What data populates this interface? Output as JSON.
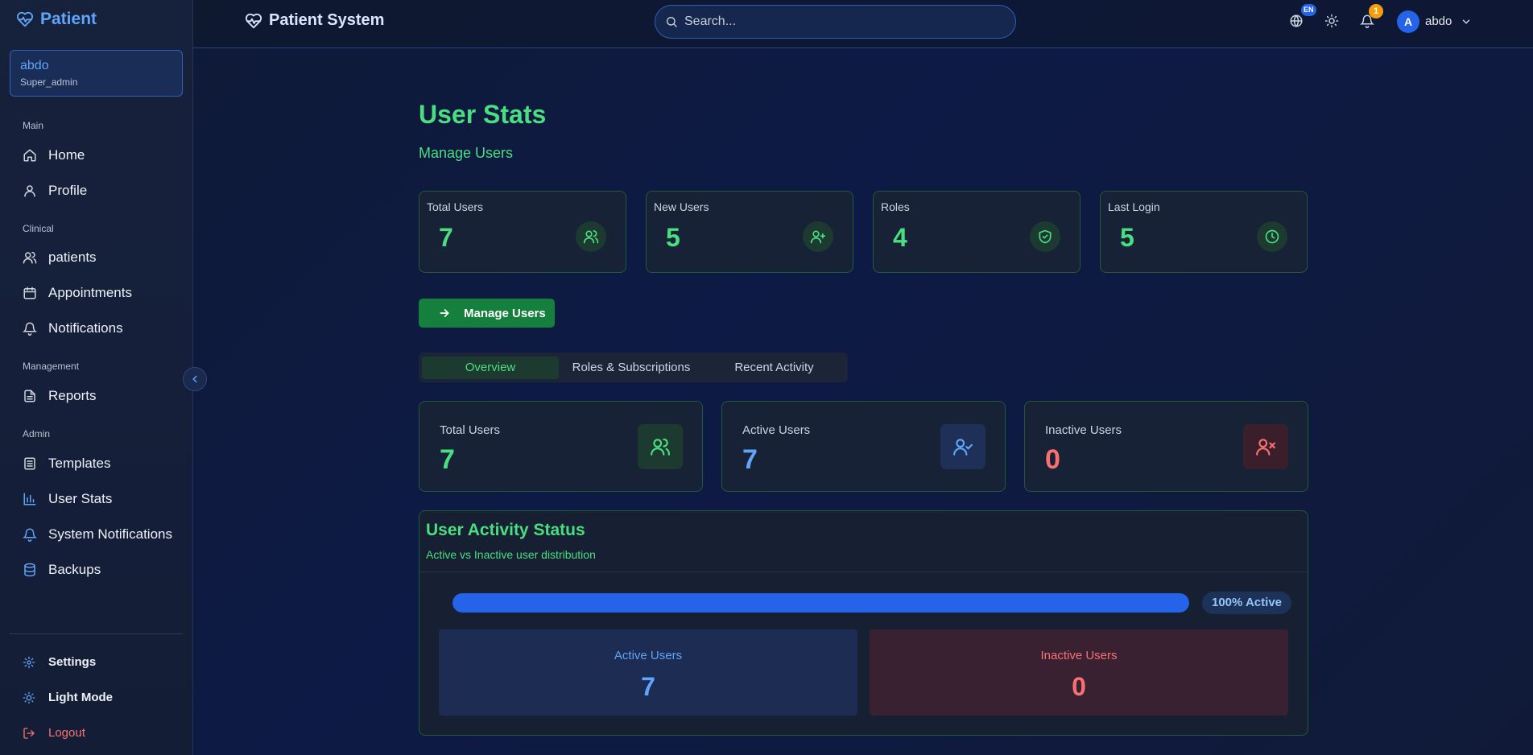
{
  "colors": {
    "accent_green": "#4ade80",
    "accent_blue": "#60a5fa",
    "danger_red": "#f87171",
    "progress_blue": "#2563eb",
    "button_green": "#15803d"
  },
  "sidebar": {
    "brand": "Patient",
    "user": {
      "name": "abdo",
      "role": "Super_admin"
    },
    "sections": {
      "main": "Main",
      "clinical": "Clinical",
      "management": "Management",
      "admin": "Admin"
    },
    "items": [
      {
        "label": "Home",
        "icon": "home-icon"
      },
      {
        "label": "Profile",
        "icon": "user-icon"
      },
      {
        "label": "patients",
        "icon": "users-icon"
      },
      {
        "label": "Appointments",
        "icon": "calendar-icon"
      },
      {
        "label": "Notifications",
        "icon": "bell-icon"
      },
      {
        "label": "Reports",
        "icon": "file-text-icon"
      },
      {
        "label": "Templates",
        "icon": "list-icon"
      },
      {
        "label": "User Stats",
        "icon": "bar-chart-icon",
        "active": true
      },
      {
        "label": "System Notifications",
        "icon": "bell-icon"
      },
      {
        "label": "Backups",
        "icon": "database-icon"
      }
    ],
    "bottom": {
      "settings": "Settings",
      "light_mode": "Light Mode",
      "logout": "Logout"
    }
  },
  "header": {
    "title": "Patient System",
    "search_placeholder": "Search...",
    "language_badge": "EN",
    "notification_count": "1",
    "avatar_initial": "A",
    "user_name": "abdo"
  },
  "main": {
    "title": "User Stats",
    "subtitle": "Manage Users",
    "stats": [
      {
        "label": "Total Users",
        "value": "7",
        "icon": "users-icon"
      },
      {
        "label": "New Users",
        "value": "5",
        "icon": "user-plus-icon"
      },
      {
        "label": "Roles",
        "value": "4",
        "icon": "shield-check-icon"
      },
      {
        "label": "Last Login",
        "value": "5",
        "icon": "clock-icon"
      }
    ],
    "manage_button": "Manage Users",
    "tabs": [
      "Overview",
      "Roles & Subscriptions",
      "Recent Activity"
    ],
    "active_tab": 0,
    "overview_cards": [
      {
        "label": "Total Users",
        "value": "7",
        "color": "#4ade80",
        "icon": "users-icon"
      },
      {
        "label": "Active Users",
        "value": "7",
        "color": "#60a5fa",
        "icon": "user-check-icon"
      },
      {
        "label": "Inactive Users",
        "value": "0",
        "color": "#f87171",
        "icon": "user-x-icon"
      }
    ],
    "activity": {
      "title": "User Activity Status",
      "subtitle": "Active vs Inactive user distribution",
      "active_fraction": 1.0,
      "pill": "100% Active",
      "active_label": "Active Users",
      "active_value": "7",
      "inactive_label": "Inactive Users",
      "inactive_value": "0"
    }
  }
}
